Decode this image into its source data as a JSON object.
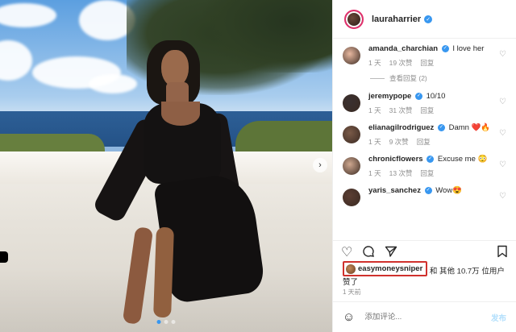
{
  "post": {
    "author": "lauraharrier",
    "carousel_dots": 3
  },
  "comments": [
    {
      "user": "amanda_charchian",
      "verified": true,
      "text": "I love her",
      "time": "1 天",
      "likes": "19 次赞",
      "reply": "回复",
      "avatar_color": "#e8b8a0"
    },
    {
      "user": "jeremypope",
      "verified": true,
      "text": "10/10",
      "time": "1 天",
      "likes": "31 次赞",
      "reply": "回复",
      "avatar_color": "#3a3030"
    },
    {
      "user": "elianagilrodriguez",
      "verified": true,
      "text": "Damn ❤️🔥",
      "time": "1 天",
      "likes": "9 次赞",
      "reply": "回复",
      "avatar_color": "#7a5a48"
    },
    {
      "user": "chronicflowers",
      "verified": true,
      "text": "Excuse me 😳",
      "time": "1 天",
      "likes": "13 次赞",
      "reply": "回复",
      "avatar_color": "#cfa890"
    },
    {
      "user": "yaris_sanchez",
      "verified": true,
      "text": "Wow😍",
      "time": "",
      "likes": "",
      "reply": "",
      "avatar_color": "#5b3e33"
    }
  ],
  "view_replies": "查看回复 (2)",
  "likes": {
    "liker": "easymoneysniper",
    "rest": "和 其他 10.7万 位用户",
    "suffix": "赞了"
  },
  "timestamp": "1 天前",
  "add_comment": {
    "placeholder": "添加评论...",
    "post_label": "发布"
  },
  "icons": {
    "heart": "heart-icon",
    "comment": "comment-icon",
    "share": "share-icon",
    "save": "bookmark-icon",
    "emoji": "emoji-icon"
  },
  "colors": {
    "verified": "#3897f0",
    "highlight_box": "#d0312d",
    "post_disabled": "#b2dffc"
  }
}
